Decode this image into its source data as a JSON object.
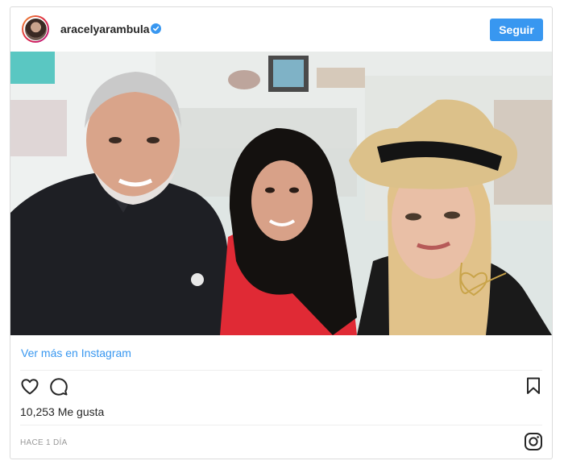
{
  "post": {
    "username": "aracelyarambula",
    "verified": true,
    "follow_label": "Seguir",
    "view_link": "Ver más en Instagram",
    "likes_text": "10,253 Me gusta",
    "timestamp": "HACE 1 DÍA"
  },
  "icons": {
    "verified": "verified-badge-icon",
    "like": "heart-icon",
    "comment": "comment-bubble-icon",
    "save": "bookmark-icon",
    "brand": "instagram-logo-icon"
  },
  "colors": {
    "accent": "#3897f0",
    "text": "#262626",
    "muted": "#999999",
    "border": "#dbdbdb"
  }
}
